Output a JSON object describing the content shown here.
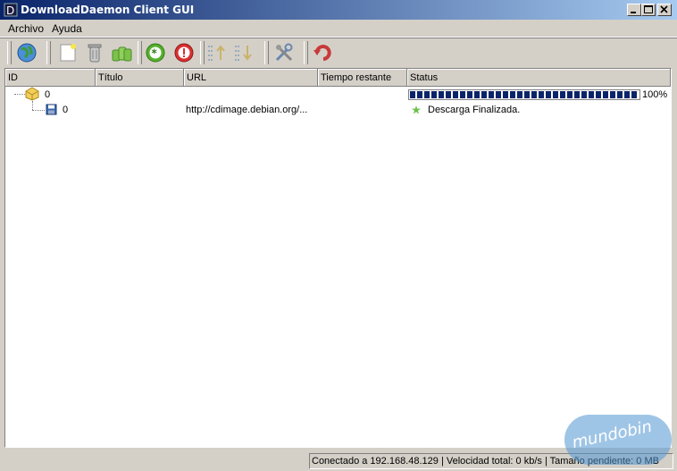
{
  "window": {
    "title": "DownloadDaemon Client GUI"
  },
  "menu": {
    "archivo": "Archivo",
    "ayuda": "Ayuda"
  },
  "toolbar": {
    "buttons": [
      "connect-globe-icon",
      "new-download-icon",
      "delete-trash-icon",
      "delete-finished-icon",
      "activate-icon",
      "deactivate-icon",
      "move-up-icon",
      "move-down-icon",
      "configure-tools-icon",
      "reload-icon"
    ]
  },
  "table": {
    "columns": [
      "ID",
      "Título",
      "URL",
      "Tiempo restante",
      "Status"
    ],
    "package": {
      "id": "0",
      "progress": 100,
      "progress_label": "100%"
    },
    "download": {
      "id": "0",
      "url": "http://cdimage.debian.org/...",
      "status": "Descarga Finalizada."
    }
  },
  "statusbar": {
    "text": "Conectado a 192.168.48.129 | Velocidad total: 0 kb/s | Tamaño pendiente: 0 MB"
  },
  "watermark": {
    "text": "mundobin"
  },
  "colors": {
    "title_start": "#0a246a",
    "title_end": "#a6caf0",
    "progress": "#0a246a",
    "window": "#d4d0c8"
  }
}
